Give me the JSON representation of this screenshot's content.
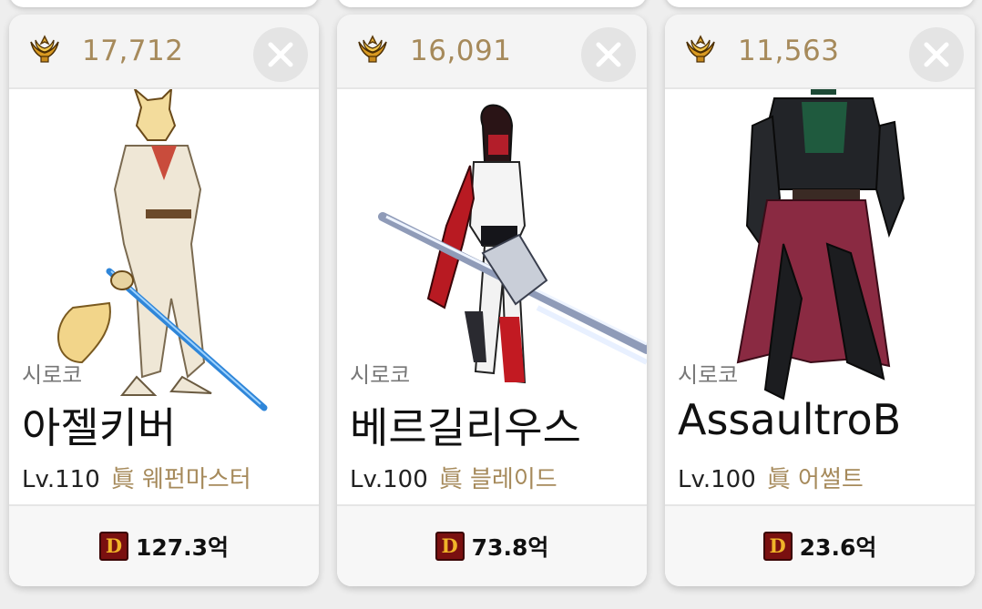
{
  "cards": [
    {
      "fame": "17,712",
      "server": "시로코",
      "name": "아젤키버",
      "level": "Lv.110",
      "job": "眞 웨펀마스터",
      "gold": "127.3억",
      "sprite_icon": "swordsman-character-sprite"
    },
    {
      "fame": "16,091",
      "server": "시로코",
      "name": "베르길리우스",
      "level": "Lv.100",
      "job": "眞 블레이드",
      "gold": "73.8억",
      "sprite_icon": "blade-character-sprite"
    },
    {
      "fame": "11,563",
      "server": "시로코",
      "name": "AssaultroB",
      "level": "Lv.100",
      "job": "眞 어썰트",
      "gold": "23.6억",
      "sprite_icon": "assault-character-sprite"
    }
  ],
  "icons": {
    "fame": "fame-laurel-icon",
    "close": "close-icon",
    "gold": "dungeon-gold-icon",
    "gold_letter": "D"
  },
  "colors": {
    "fame_text": "#a68a5b",
    "job_text": "#a68a5b",
    "close_bg": "#e4e4e4"
  }
}
